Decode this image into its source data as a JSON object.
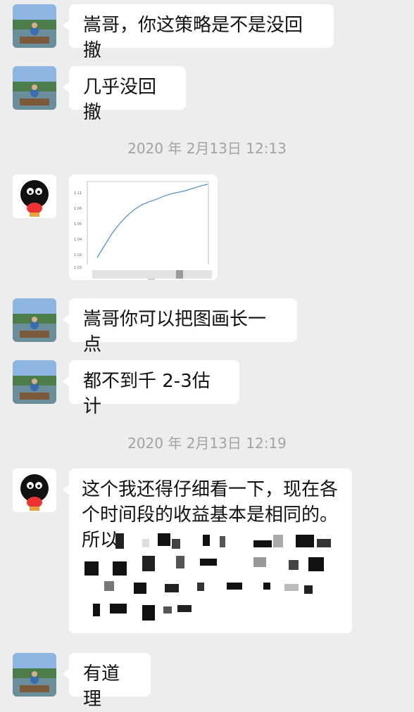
{
  "messages": [
    {
      "text": "嵩哥，你这策略是不是没回撤"
    },
    {
      "text": "几乎没回撤"
    },
    {
      "timestamp": "2020 年 2月13日 12:13"
    },
    {
      "chart_ticks": [
        "1.11",
        "1.06",
        "1.05",
        "1.04",
        "1.02",
        "1.03"
      ]
    },
    {
      "text": "嵩哥你可以把图画长一点"
    },
    {
      "text": "都不到千 2-3估计"
    },
    {
      "timestamp": "2020 年 2月13日 12:19"
    },
    {
      "line1": "这个我还得仔细看一下，现在各",
      "line2": "个时间段的收益基本是相同的。",
      "line3": "所以"
    },
    {
      "text": "有道理"
    }
  ],
  "chart_data": {
    "type": "line",
    "title": "",
    "xlabel": "",
    "ylabel": "",
    "ytick_labels": [
      "1.11",
      "1.06",
      "1.05",
      "1.04",
      "1.02",
      "1.03"
    ],
    "series": [
      {
        "values": [
          1.02,
          1.035,
          1.05,
          1.062,
          1.072,
          1.08,
          1.086,
          1.09,
          1.093,
          1.097,
          1.1,
          1.102,
          1.104,
          1.107,
          1.11,
          1.112
        ]
      }
    ]
  },
  "colors": {
    "background": "#ededed",
    "bubble": "#ffffff",
    "timestamp": "#a3a3a3",
    "chart_line": "#4a8fc8"
  }
}
